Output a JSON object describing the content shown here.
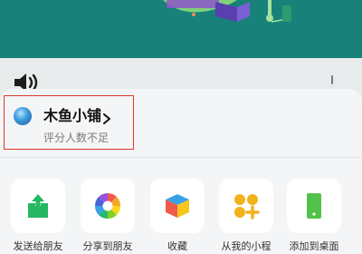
{
  "app": {
    "name": "木鱼小铺",
    "rating_text": "评分人数不足"
  },
  "actions": [
    {
      "label": "发送给朋友",
      "icon": "share-arrow-icon"
    },
    {
      "label": "分享到朋友",
      "icon": "moments-aperture-icon"
    },
    {
      "label": "收藏",
      "icon": "favorite-cube-icon"
    },
    {
      "label": "从我的小程",
      "icon": "mini-program-icon"
    },
    {
      "label": "添加到桌面",
      "icon": "add-to-desktop-icon"
    }
  ],
  "colors": {
    "banner": "#17817a",
    "highlight": "#d83b2f",
    "share_green": "#25b864",
    "mini_program_yellow": "#f2b21c",
    "desktop_green": "#52c24a"
  }
}
